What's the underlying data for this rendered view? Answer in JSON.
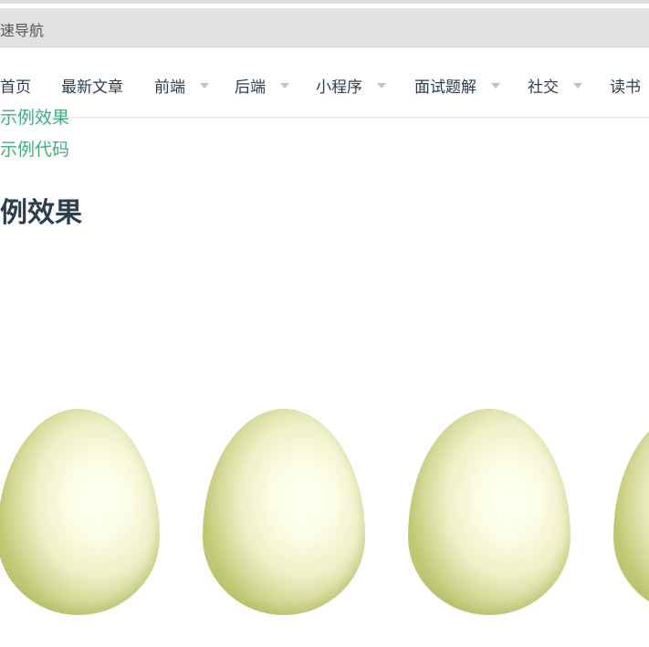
{
  "quick_nav": {
    "label": "速导航"
  },
  "navbar": {
    "items": [
      {
        "label": "首页"
      },
      {
        "label": "最新文章"
      },
      {
        "label": "前端"
      },
      {
        "label": "后端"
      },
      {
        "label": "小程序"
      },
      {
        "label": "面试题解"
      },
      {
        "label": "社交"
      },
      {
        "label": "读书"
      }
    ]
  },
  "toc": {
    "links": [
      {
        "label": "示例效果"
      },
      {
        "label": "示例代码"
      }
    ]
  },
  "content": {
    "heading": "例效果",
    "egg_count": 4
  },
  "colors": {
    "link": "#3eaf7c",
    "text": "#2c3e50",
    "egg_light": "#fcfde6",
    "egg_edge": "#c2c873"
  }
}
